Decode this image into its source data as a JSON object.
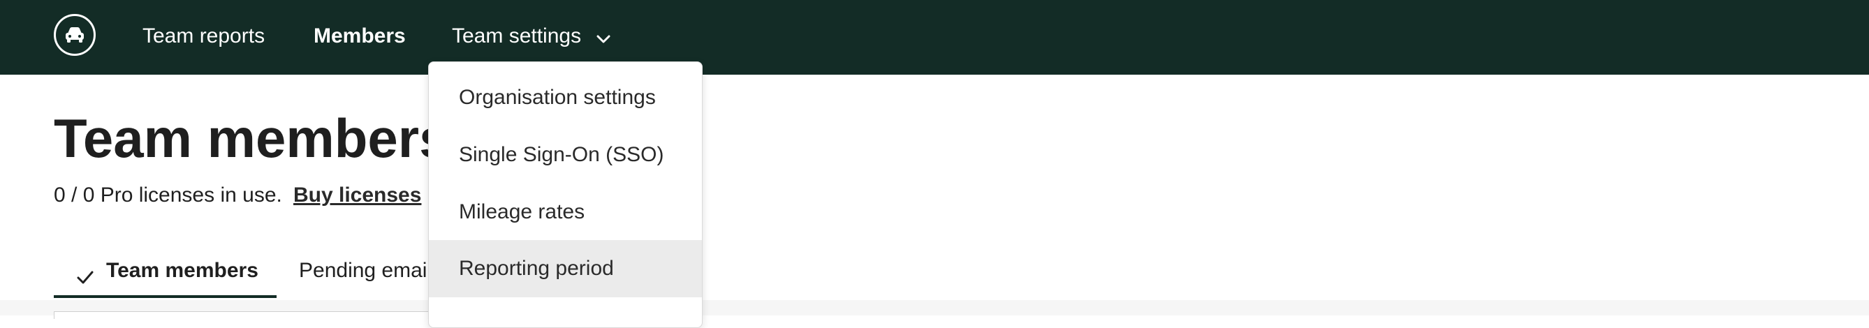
{
  "topbar": {
    "background": "#132c26",
    "logo_icon": "car-icon",
    "nav": {
      "team_reports": "Team reports",
      "members": "Members",
      "team_settings": "Team settings"
    }
  },
  "dropdown": {
    "items": [
      {
        "label": "Organisation settings"
      },
      {
        "label": "Single Sign-On (SSO)"
      },
      {
        "label": "Mileage rates"
      },
      {
        "label": "Reporting period",
        "highlighted": true
      }
    ]
  },
  "main": {
    "title": "Team members",
    "licenses_text": "0 / 0 Pro licenses in use.",
    "buy_link": "Buy licenses",
    "tabs": [
      {
        "label": "Team members",
        "active": true,
        "icon": "check-icon"
      },
      {
        "label": "Pending email"
      }
    ]
  }
}
